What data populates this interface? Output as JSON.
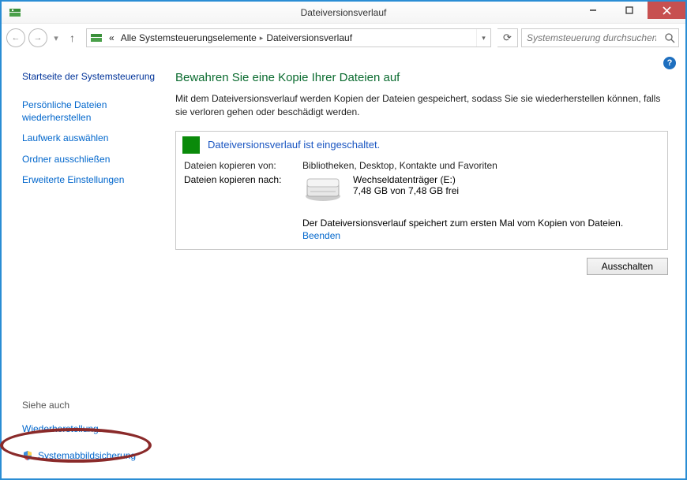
{
  "window_title": "Dateiversionsverlauf",
  "breadcrumb": {
    "prefix": "«",
    "seg1": "Alle Systemsteuerungselemente",
    "seg2": "Dateiversionsverlauf"
  },
  "search_placeholder": "Systemsteuerung durchsuchen",
  "sidebar": {
    "home": "Startseite der Systemsteuerung",
    "links": [
      "Persönliche Dateien wiederherstellen",
      "Laufwerk auswählen",
      "Ordner ausschließen",
      "Erweiterte Einstellungen"
    ],
    "see_also_header": "Siehe auch",
    "see_also": [
      "Wiederherstellung",
      "Systemabbildsicherung"
    ]
  },
  "main": {
    "heading": "Bewahren Sie eine Kopie Ihrer Dateien auf",
    "description": "Mit dem Dateiversionsverlauf werden Kopien der Dateien gespeichert, sodass Sie sie wiederherstellen können, falls sie verloren gehen oder beschädigt werden.",
    "status_label": "Dateiversionsverlauf ist eingeschaltet.",
    "copy_from_key": "Dateien kopieren von:",
    "copy_from_val": "Bibliotheken, Desktop, Kontakte und Favoriten",
    "copy_to_key": "Dateien kopieren nach:",
    "drive_name": "Wechseldatenträger (E:)",
    "drive_space": "7,48 GB von 7,48 GB frei",
    "activity": "Der Dateiversionsverlauf speichert zum ersten Mal vom Kopien von Dateien.",
    "stop_link": "Beenden",
    "toggle_button": "Ausschalten"
  }
}
